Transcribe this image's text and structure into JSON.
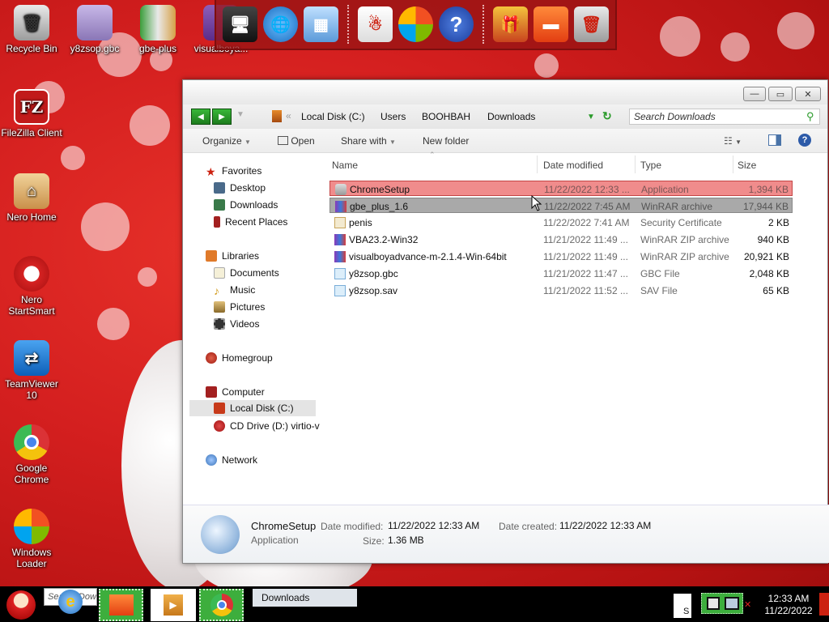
{
  "desktop": {
    "icons": [
      {
        "label": "Recycle Bin",
        "glyph": "trash-icon"
      },
      {
        "label": "y8zsop.gbc",
        "glyph": "file-icon"
      },
      {
        "label": "gbe-plus",
        "glyph": "folder-icon"
      },
      {
        "label": "visualboya...",
        "glyph": "archive-icon"
      },
      {
        "label": "FileZilla Client",
        "glyph": "filezilla-icon"
      },
      {
        "label": "Nero Home",
        "glyph": "nero-home-icon"
      },
      {
        "label": "Nero StartSmart",
        "glyph": "nero-icon"
      },
      {
        "label": "TeamViewer 10",
        "glyph": "teamviewer-icon"
      },
      {
        "label": "Google Chrome",
        "glyph": "chrome-icon"
      },
      {
        "label": "Windows Loader",
        "glyph": "windows-loader-icon"
      }
    ]
  },
  "window": {
    "breadcrumb": [
      "Local Disk (C:)",
      "Users",
      "BOOHBAH",
      "Downloads"
    ],
    "search_placeholder": "Search Downloads",
    "toolbar": {
      "organize": "Organize",
      "open": "Open",
      "share_with": "Share with",
      "new_folder": "New folder"
    },
    "nav": {
      "favorites": "Favorites",
      "desktop": "Desktop",
      "downloads": "Downloads",
      "recent_places": "Recent Places",
      "libraries": "Libraries",
      "documents": "Documents",
      "music": "Music",
      "pictures": "Pictures",
      "videos": "Videos",
      "homegroup": "Homegroup",
      "computer": "Computer",
      "local_disk": "Local Disk (C:)",
      "cd_drive": "CD Drive (D:) virtio-v",
      "network": "Network"
    },
    "columns": {
      "name": "Name",
      "date_modified": "Date modified",
      "type": "Type",
      "size": "Size"
    },
    "files": [
      {
        "name": "ChromeSetup",
        "date": "11/22/2022 12:33 ...",
        "type": "Application",
        "size": "1,394 KB"
      },
      {
        "name": "gbe_plus_1.6",
        "date": "11/22/2022 7:45 AM",
        "type": "WinRAR archive",
        "size": "17,944 KB"
      },
      {
        "name": "penis",
        "date": "11/22/2022 7:41 AM",
        "type": "Security Certificate",
        "size": "2 KB"
      },
      {
        "name": "VBA23.2-Win32",
        "date": "11/21/2022 11:49 ...",
        "type": "WinRAR ZIP archive",
        "size": "940 KB"
      },
      {
        "name": "visualboyadvance-m-2.1.4-Win-64bit",
        "date": "11/21/2022 11:49 ...",
        "type": "WinRAR ZIP archive",
        "size": "20,921 KB"
      },
      {
        "name": "y8zsop.gbc",
        "date": "11/21/2022 11:47 ...",
        "type": "GBC File",
        "size": "2,048 KB"
      },
      {
        "name": "y8zsop.sav",
        "date": "11/21/2022 11:52 ...",
        "type": "SAV File",
        "size": "65 KB"
      }
    ],
    "details": {
      "name": "ChromeSetup",
      "type": "Application",
      "date_modified_label": "Date modified:",
      "date_modified": "11/22/2022 12:33 AM",
      "date_created_label": "Date created:",
      "date_created": "11/22/2022 12:33 AM",
      "size_label": "Size:",
      "size": "1.36 MB"
    }
  },
  "taskbar": {
    "search_text": "Search Down",
    "active_window": "Downloads",
    "tray_letter": "S",
    "time": "12:33 AM",
    "date": "11/22/2022"
  },
  "colors": {
    "desktop_red": "#d41f1f",
    "selection_red": "#f08c8c",
    "selection_gray": "#a9a9a9",
    "nav_green": "#2a9a2a"
  }
}
